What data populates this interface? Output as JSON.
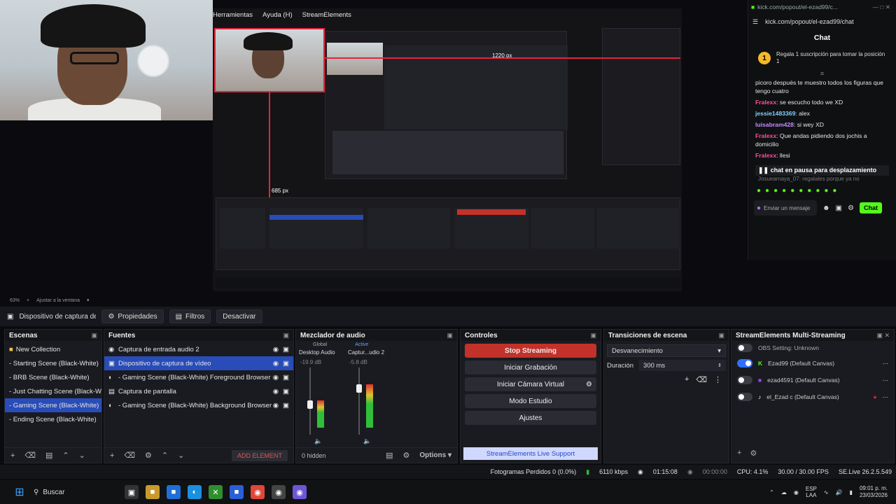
{
  "preview_menu": [
    "Herramientas",
    "Ayuda (H)",
    "StreamElements"
  ],
  "preview_labels": {
    "dim_top": "1220 px",
    "dim_left": "685 px"
  },
  "chat": {
    "tab_url": "kick.com/popout/el-ezad99/c...",
    "url": "kick.com/popout/el-ezad99/chat",
    "title": "Chat",
    "gift_banner": "Regala 1 suscripción para tomar la posición 1",
    "messages": [
      {
        "user": "",
        "text": "picoro después te muestro todos los figuras que tengo cuatro"
      },
      {
        "user": "Fralexx",
        "text": ": se escucho todo we XD"
      },
      {
        "user": "jessie1483369",
        "text": ": alex"
      },
      {
        "user": "luisabram428",
        "text": ": si wey XD"
      },
      {
        "user": "Fralexx",
        "text": ": Que andas pidiendo dos jochis a domicilio"
      },
      {
        "user": "Fralexx",
        "text": ": llesi"
      }
    ],
    "pause_notice": "chat en pausa para desplazamiento",
    "partial_msg": "Josueamaya_07: regalales porque ya no",
    "input_placeholder": "Enviar un mensaje",
    "send_label": "Chat"
  },
  "zoom": {
    "value": "63%",
    "fit_label": "Ajustar a la ventana"
  },
  "source_toolbar": {
    "source_name": "Dispositivo de captura de v",
    "properties": "Propiedades",
    "filters": "Filtros",
    "deactivate": "Desactivar"
  },
  "scenes": {
    "title": "Escenas",
    "items": [
      {
        "label": "New Collection",
        "folder": true
      },
      {
        "label": "- Starting Scene (Black-White)"
      },
      {
        "label": "- BRB Scene (Black-White)"
      },
      {
        "label": "- Just Chatting Scene (Black-Whit"
      },
      {
        "label": "- Gaming Scene (Black-White)",
        "selected": true
      },
      {
        "label": "- Ending Scene (Black-White)"
      }
    ]
  },
  "sources": {
    "title": "Fuentes",
    "items": [
      {
        "label": "Captura de entrada audio 2",
        "icon": "mic-icon"
      },
      {
        "label": "Dispositivo de captura de vídeo",
        "icon": "camera-icon",
        "selected": true
      },
      {
        "label": "- Gaming Scene (Black-White)  Foreground Browser S",
        "icon": "globe-icon"
      },
      {
        "label": "Captura de pantalla",
        "icon": "monitor-icon"
      },
      {
        "label": "- Gaming Scene (Black-White)  Background Browser S",
        "icon": "globe-icon"
      }
    ],
    "add_element": "ADD ELEMENT"
  },
  "mixer": {
    "title": "Mezclador de audio",
    "tabs": [
      "Global",
      "Active"
    ],
    "channels": [
      {
        "name": "Desktop Audio",
        "db": "-19.9 dB",
        "level": 0.45
      },
      {
        "name": "Captur...udio 2",
        "db": "-5.8 dB",
        "level": 0.72
      }
    ],
    "ticks": [
      "0",
      "-6",
      "-12",
      "-18",
      "-24",
      "-30",
      "-36",
      "-42",
      "-48",
      "-54",
      "-60"
    ],
    "hidden": "0 hidden",
    "options": "Options"
  },
  "controls": {
    "title": "Controles",
    "buttons": [
      "Stop Streaming",
      "Iniciar Grabación",
      "Iniciar Cámara Virtual",
      "Modo Estudio",
      "Ajustes"
    ],
    "support": "StreamElements Live Support"
  },
  "transitions": {
    "title": "Transiciones de escena",
    "selected": "Desvanecimiento",
    "duration_label": "Duración",
    "duration_value": "300 ms"
  },
  "multistream": {
    "title": "StreamElements Multi-Streaming",
    "status": "OBS Setting: Unknown",
    "targets": [
      {
        "name": "Ezad99 (Default Canvas)",
        "on": true,
        "color": "#53fc18",
        "icon": "kick-icon"
      },
      {
        "name": "ezad4591 (Default Canvas)",
        "on": false,
        "color": "#9146ff",
        "icon": "twitch-icon"
      },
      {
        "name": "el_Ezad c (Default Canvas)",
        "on": false,
        "color": "#ffffff",
        "icon": "tiktok-icon"
      }
    ]
  },
  "status": {
    "dropped": "Fotogramas Perdidos 0 (0.0%)",
    "bitrate": "6110 kbps",
    "live_time": "01:15:08",
    "rec_time": "00:00:00",
    "cpu": "CPU: 4.1%",
    "fps": "30.00 / 30.00 FPS",
    "version": "SE.Live 26.2.5.549"
  },
  "taskbar": {
    "search": "Buscar",
    "lang": "ESP",
    "lang2": "LAA",
    "time": "09:01 p. m.",
    "date": "23/03/2026"
  }
}
